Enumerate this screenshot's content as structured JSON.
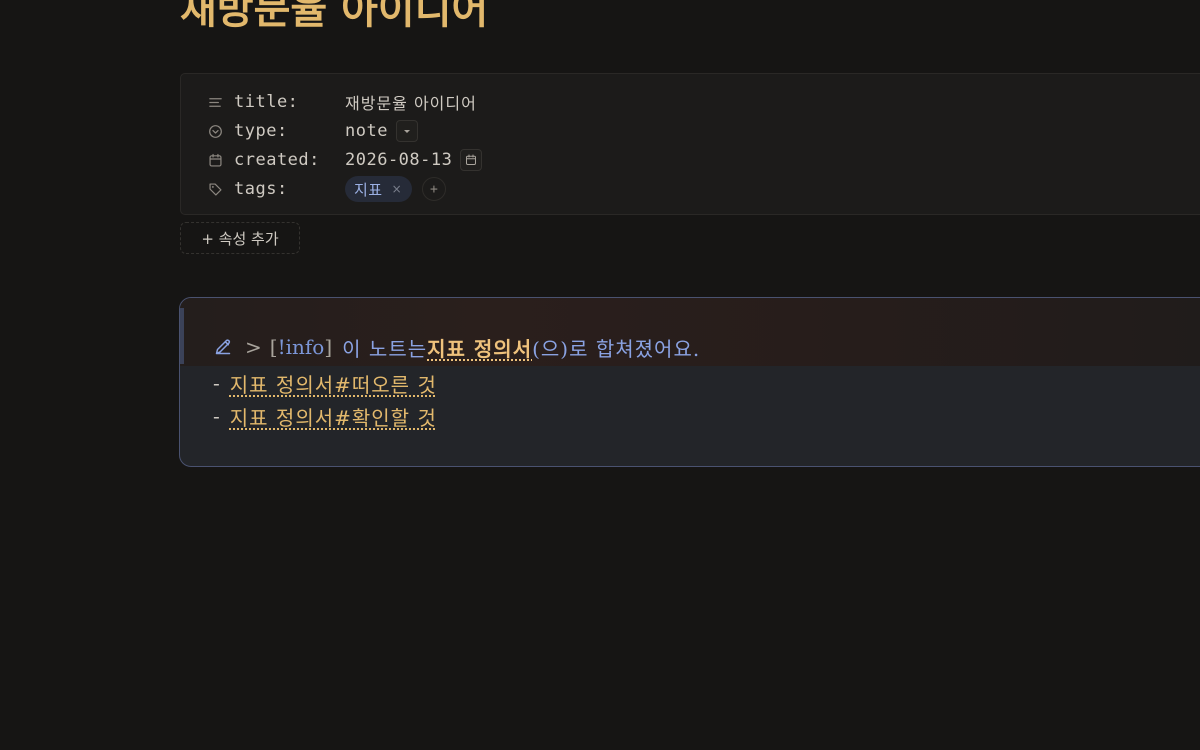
{
  "note": {
    "title": "재방문율 아이디어"
  },
  "properties": {
    "title": {
      "key": "title:",
      "value": "재방문율 아이디어",
      "icon": "text-lines-icon"
    },
    "type": {
      "key": "type:",
      "value": "note",
      "icon": "circle-chevron-icon"
    },
    "created": {
      "key": "created:",
      "value": "2026-08-13",
      "icon": "calendar-icon"
    },
    "tags": {
      "key": "tags:",
      "items": [
        "지표"
      ],
      "remove_glyph": "×",
      "add_glyph": "+",
      "icon": "tag-icon"
    }
  },
  "add_property_label": "+ 속성 추가",
  "callout": {
    "gt": ">",
    "bracket_open": "[",
    "type_marker": "!info",
    "bracket_close": "]",
    "text": "이 노트는 ",
    "link": "지표 정의서",
    "suffix": "(으)로 합쳐졌어요.",
    "list_dash": "-",
    "items": [
      "지표 정의서#떠오른 것",
      "지표 정의서#확인할 것"
    ]
  },
  "colors": {
    "background": "#161514",
    "accent_gold": "#e2b86c",
    "callout_blue": "#8aa2e2",
    "callout_border": "#4a5270"
  }
}
